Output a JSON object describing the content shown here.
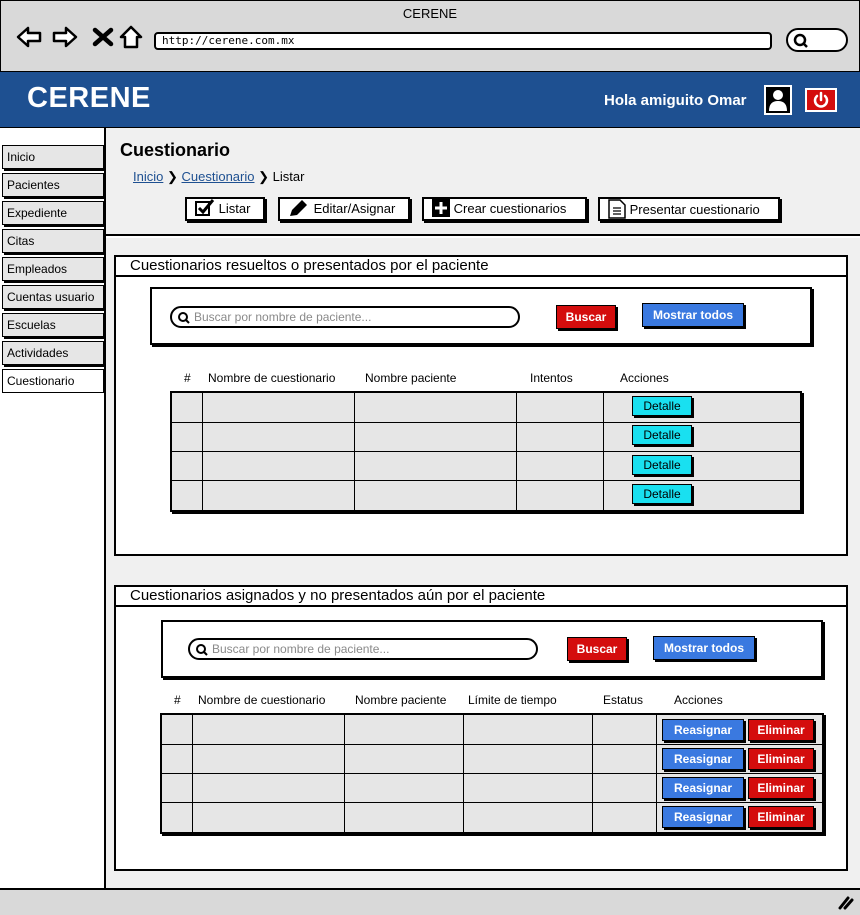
{
  "browser": {
    "window_title": "CERENE",
    "url": "http://cerene.com.mx",
    "icons": [
      "back-arrow-icon",
      "forward-arrow-icon",
      "close-x-icon",
      "home-icon",
      "search-icon"
    ]
  },
  "header": {
    "brand": "CERENE",
    "greeting": "Hola amiguito Omar",
    "bg_color": "#1e5091",
    "icons": [
      "user-icon",
      "power-icon"
    ]
  },
  "sidebar": {
    "items": [
      {
        "label": "Inicio"
      },
      {
        "label": "Pacientes"
      },
      {
        "label": "Expediente"
      },
      {
        "label": "Citas"
      },
      {
        "label": "Empleados"
      },
      {
        "label": "Cuentas usuario"
      },
      {
        "label": "Escuelas"
      },
      {
        "label": "Actividades"
      },
      {
        "label": "Cuestionario",
        "active": true
      }
    ]
  },
  "page": {
    "title": "Cuestionario",
    "breadcrumb": [
      "Inicio",
      "Cuestionario",
      "Listar"
    ],
    "toolbar": {
      "listar": "Listar",
      "editar": "Editar/Asignar",
      "crear": "Crear cuestionarios",
      "presentar": "Presentar cuestionario"
    }
  },
  "panel1": {
    "title": "Cuestionarios resueltos o presentados por el paciente",
    "search_placeholder": "Buscar por nombre de paciente...",
    "buscar": "Buscar",
    "mostrar": "Mostrar todos",
    "columns": [
      "#",
      "Nombre de cuestionario",
      "Nombre paciente",
      "Intentos",
      "Acciones"
    ],
    "rows": [
      {
        "action": "Detalle"
      },
      {
        "action": "Detalle"
      },
      {
        "action": "Detalle"
      },
      {
        "action": "Detalle"
      }
    ]
  },
  "panel2": {
    "title": "Cuestionarios asignados y no presentados aún por el paciente",
    "search_placeholder": "Buscar por nombre de paciente...",
    "buscar": "Buscar",
    "mostrar": "Mostrar todos",
    "columns": [
      "#",
      "Nombre de cuestionario",
      "Nombre paciente",
      "Límite de tiempo",
      "Estatus",
      "Acciones"
    ],
    "rows": [
      {
        "reasignar": "Reasignar",
        "eliminar": "Eliminar"
      },
      {
        "reasignar": "Reasignar",
        "eliminar": "Eliminar"
      },
      {
        "reasignar": "Reasignar",
        "eliminar": "Eliminar"
      },
      {
        "reasignar": "Reasignar",
        "eliminar": "Eliminar"
      }
    ]
  },
  "colors": {
    "red": "#d40d0d",
    "blue": "#3a79e0",
    "cyan": "#19e0f0"
  }
}
